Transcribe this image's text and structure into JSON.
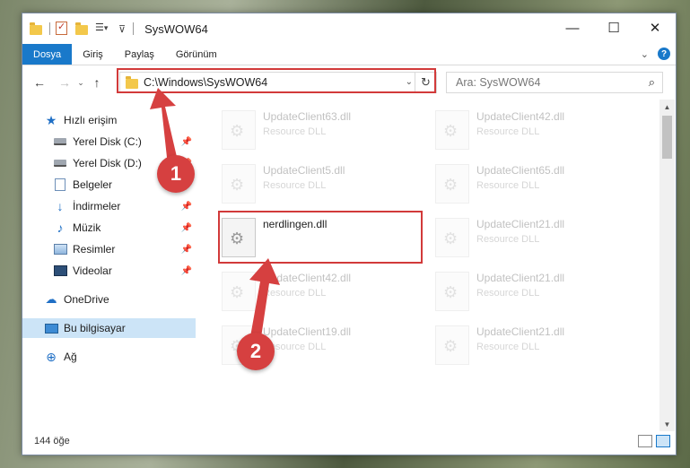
{
  "window": {
    "title": "SysWOW64",
    "controls": {
      "minimize": "—",
      "maximize": "☐",
      "close": "✕"
    }
  },
  "ribbon": {
    "tabs": [
      {
        "label": "Dosya",
        "active": true
      },
      {
        "label": "Giriş",
        "active": false
      },
      {
        "label": "Paylaş",
        "active": false
      },
      {
        "label": "Görünüm",
        "active": false
      }
    ]
  },
  "nav": {
    "address": "C:\\Windows\\SysWOW64",
    "search_placeholder": "Ara: SysWOW64"
  },
  "sidebar": {
    "items": [
      {
        "label": "Hızlı erişim",
        "icon": "star-icon"
      },
      {
        "label": "Yerel Disk (C:)",
        "icon": "drive-icon",
        "pinned": true
      },
      {
        "label": "Yerel Disk (D:)",
        "icon": "drive-icon",
        "pinned": true
      },
      {
        "label": "Belgeler",
        "icon": "document-icon",
        "pinned": true
      },
      {
        "label": "İndirmeler",
        "icon": "download-icon",
        "pinned": true
      },
      {
        "label": "Müzik",
        "icon": "music-icon",
        "pinned": true
      },
      {
        "label": "Resimler",
        "icon": "picture-icon",
        "pinned": true
      },
      {
        "label": "Videolar",
        "icon": "video-icon",
        "pinned": true
      },
      {
        "label": "OneDrive",
        "icon": "cloud-icon"
      },
      {
        "label": "Bu bilgisayar",
        "icon": "computer-icon",
        "selected": true
      },
      {
        "label": "Ağ",
        "icon": "network-icon"
      }
    ]
  },
  "files": [
    {
      "name": "UpdateClient63.dll",
      "type": "Resource DLL",
      "faded": true
    },
    {
      "name": "UpdateClient42.dll",
      "type": "Resource DLL",
      "faded": true
    },
    {
      "name": "UpdateClient5.dll",
      "type": "Resource DLL",
      "faded": true
    },
    {
      "name": "UpdateClient65.dll",
      "type": "Resource DLL",
      "faded": true
    },
    {
      "name": "nerdlingen.dll",
      "type": "",
      "faded": false
    },
    {
      "name": "UpdateClient21.dll",
      "type": "Resource DLL",
      "faded": true
    },
    {
      "name": "UpdateClient42.dll",
      "type": "Resource DLL",
      "faded": true
    },
    {
      "name": "UpdateClient21.dll",
      "type": "Resource DLL",
      "faded": true
    },
    {
      "name": "UpdateClient19.dll",
      "type": "Resource DLL",
      "faded": true
    },
    {
      "name": "UpdateClient21.dll",
      "type": "Resource DLL",
      "faded": true
    }
  ],
  "status": {
    "item_count": "144 öğe"
  },
  "annotations": {
    "step1": "1",
    "step2": "2",
    "color": "#d64040"
  }
}
